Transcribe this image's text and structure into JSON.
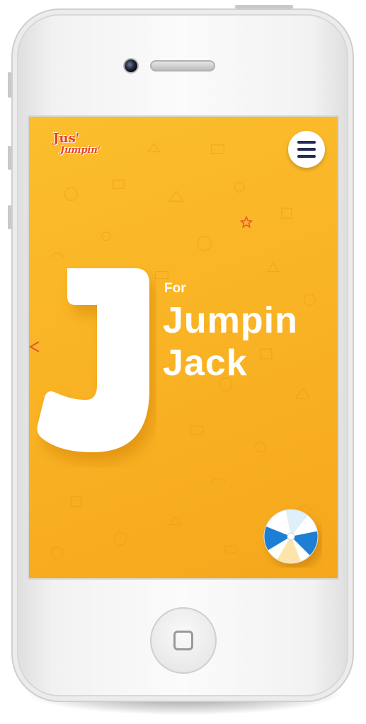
{
  "app": {
    "logo_text_line1": "Jus'",
    "logo_text_line2": "Jumpin'"
  },
  "header": {
    "menu_icon": "hamburger-menu-icon"
  },
  "hero": {
    "letter": "J",
    "for_label": "For",
    "title_line1": "Jumpin",
    "title_line2": "Jack"
  },
  "decorations": {
    "star_icon": "star-outline-icon",
    "arrow_icon": "triangle-left-icon",
    "ball_icon": "beach-ball-icon"
  },
  "colors": {
    "background": "#f9b324",
    "menu_bars": "#262b5a",
    "logo_red": "#e8402b",
    "ball_blue": "#1f7fd4"
  }
}
